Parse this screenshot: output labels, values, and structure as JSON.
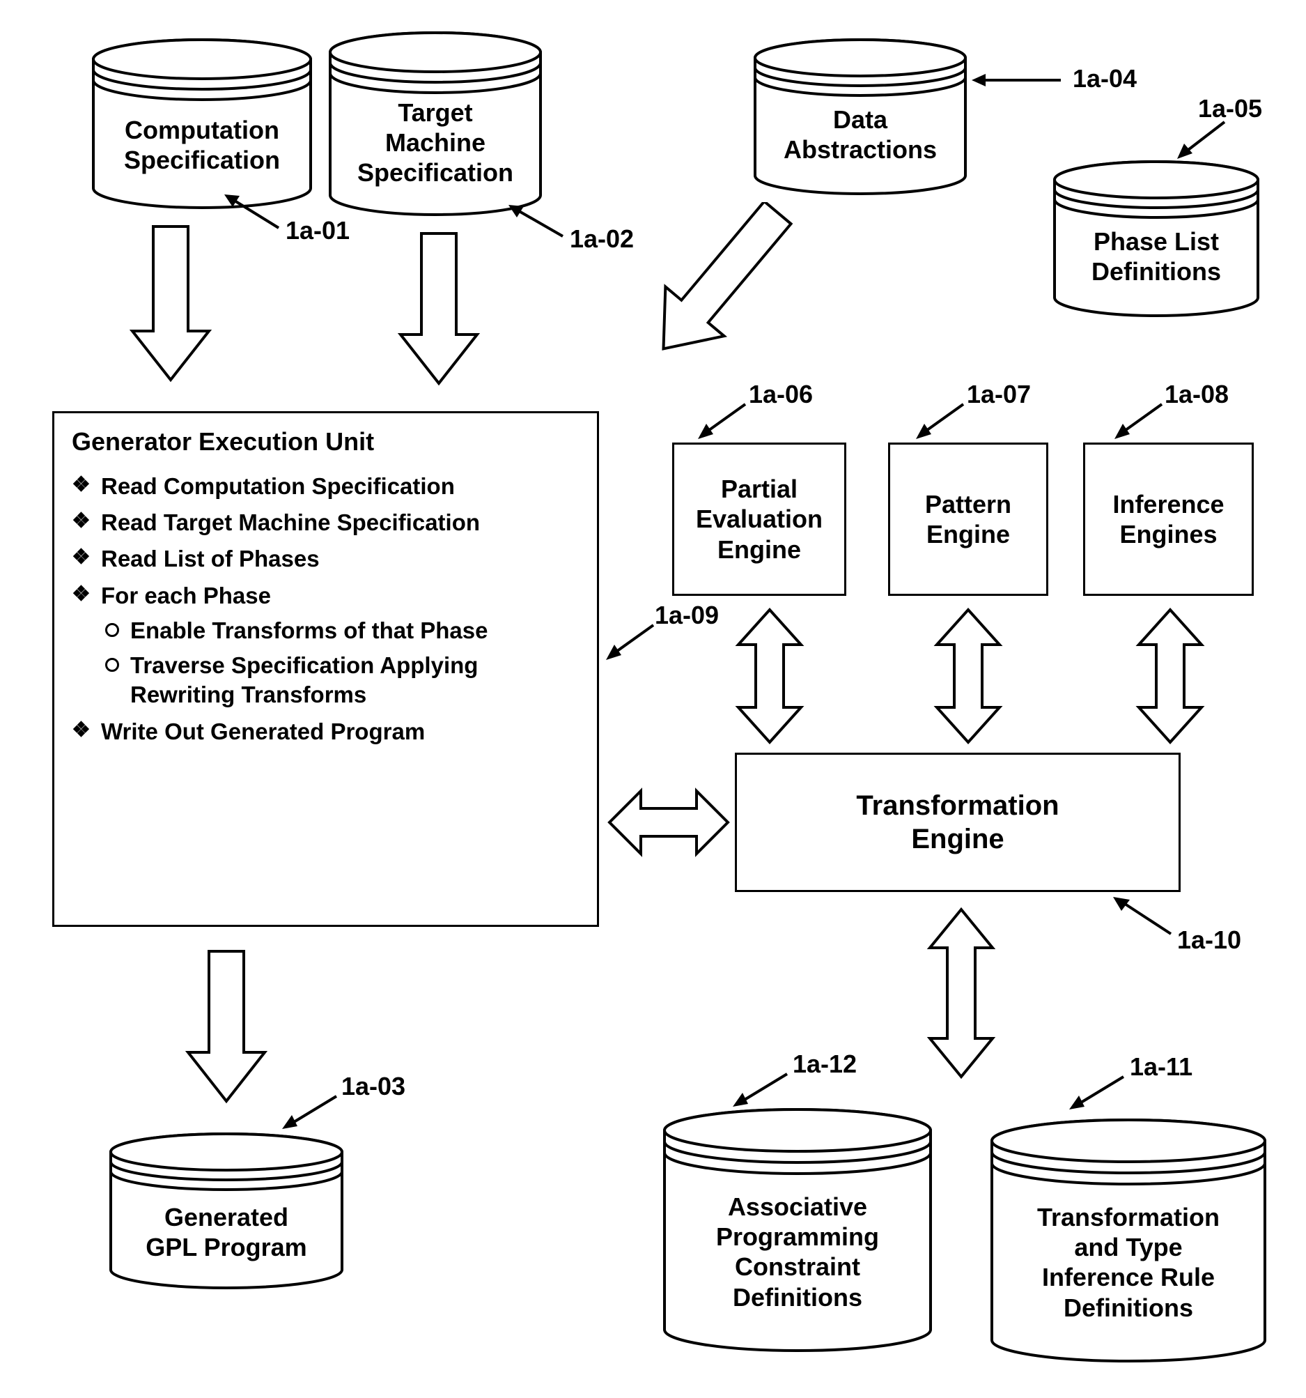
{
  "cylinders": {
    "comp_spec": {
      "line1": "Computation",
      "line2": "Specification"
    },
    "target_spec": {
      "line1": "Target",
      "line2": "Machine",
      "line3": "Specification"
    },
    "data_abs": {
      "line1": "Data",
      "line2": "Abstractions"
    },
    "phase_list": {
      "line1": "Phase List",
      "line2": "Definitions"
    },
    "gen_gpl": {
      "line1": "Generated",
      "line2": "GPL Program"
    },
    "assoc_prog": {
      "line1": "Associative",
      "line2": "Programming",
      "line3": "Constraint",
      "line4": "Definitions"
    },
    "trans_type": {
      "line1": "Transformation",
      "line2": "and Type",
      "line3": "Inference Rule",
      "line4": "Definitions"
    }
  },
  "boxes": {
    "partial_eval": {
      "line1": "Partial",
      "line2": "Evaluation",
      "line3": "Engine"
    },
    "pattern": {
      "line1": "Pattern",
      "line2": "Engine"
    },
    "inference": {
      "line1": "Inference",
      "line2": "Engines"
    },
    "transform": {
      "line1": "Transformation",
      "line2": "Engine"
    }
  },
  "geu": {
    "title": "Generator Execution Unit",
    "items": [
      "Read Computation Specification",
      "Read Target Machine Specification",
      "Read List of Phases",
      "For each Phase",
      "Write Out Generated Program"
    ],
    "subitems": [
      "Enable Transforms of that Phase",
      "Traverse Specification Applying Rewriting Transforms"
    ]
  },
  "refs": {
    "r01": "1a-01",
    "r02": "1a-02",
    "r03": "1a-03",
    "r04": "1a-04",
    "r05": "1a-05",
    "r06": "1a-06",
    "r07": "1a-07",
    "r08": "1a-08",
    "r09": "1a-09",
    "r10": "1a-10",
    "r11": "1a-11",
    "r12": "1a-12"
  }
}
